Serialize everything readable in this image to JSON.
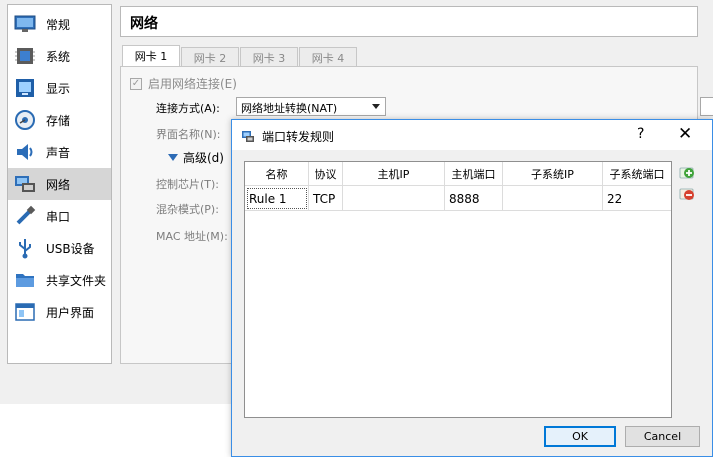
{
  "sidebar": {
    "items": [
      {
        "label": "常规",
        "icon": "general-icon"
      },
      {
        "label": "系统",
        "icon": "system-icon"
      },
      {
        "label": "显示",
        "icon": "display-icon"
      },
      {
        "label": "存储",
        "icon": "storage-icon"
      },
      {
        "label": "声音",
        "icon": "audio-icon"
      },
      {
        "label": "网络",
        "icon": "network-icon"
      },
      {
        "label": "串口",
        "icon": "serial-port-icon"
      },
      {
        "label": "USB设备",
        "icon": "usb-icon"
      },
      {
        "label": "共享文件夹",
        "icon": "shared-folder-icon"
      },
      {
        "label": "用户界面",
        "icon": "user-interface-icon"
      }
    ],
    "active": "网络"
  },
  "section_title": "网络",
  "tabs": [
    "网卡 1",
    "网卡 2",
    "网卡 3",
    "网卡 4"
  ],
  "active_tab": "网卡 1",
  "adapter": {
    "enable_label": "启用网络连接(E)",
    "enabled": true,
    "attached_label": "连接方式(A):",
    "attached_value": "网络地址转换(NAT)",
    "name_label": "界面名称(N):",
    "advanced_label": "高级(d)",
    "chip_label": "控制芯片(T):",
    "promisc_label": "混杂模式(P):",
    "mac_label": "MAC 地址(M):"
  },
  "dialog": {
    "title": "端口转发规则",
    "help": "?",
    "close": "✕",
    "columns": [
      "名称",
      "协议",
      "主机IP",
      "主机端口",
      "子系统IP",
      "子系统端口"
    ],
    "rows": [
      {
        "name": "Rule 1",
        "protocol": "TCP",
        "host_ip": "",
        "host_port": "8888",
        "guest_ip": "",
        "guest_port": "22"
      }
    ],
    "ok_label": "OK",
    "cancel_label": "Cancel"
  },
  "colors": {
    "dialog_border": "#3a8ee6",
    "add_icon": "#3fa33a",
    "remove_icon": "#d6402e",
    "advanced_arrow": "#2d6bb5"
  }
}
